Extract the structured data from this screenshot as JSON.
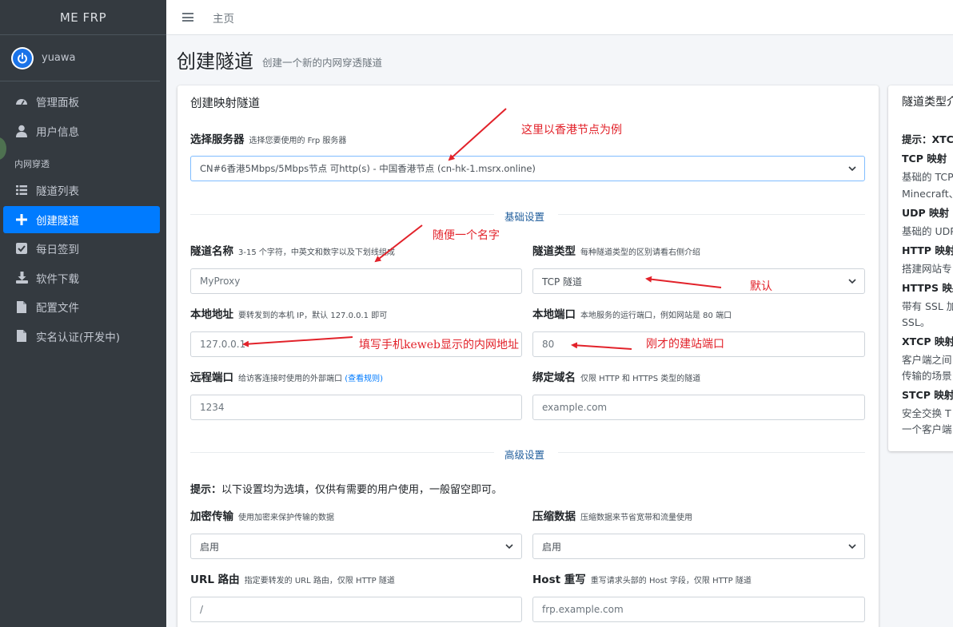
{
  "app": {
    "brand": "ME FRP",
    "username": "yuawa"
  },
  "sidebar": {
    "items": [
      {
        "label": "管理面板",
        "icon": "dashboard-icon"
      },
      {
        "label": "用户信息",
        "icon": "user-icon"
      }
    ],
    "section_header": "内网穿透",
    "section_items": [
      {
        "label": "隧道列表",
        "icon": "list-icon"
      },
      {
        "label": "创建隧道",
        "icon": "plus-icon",
        "active": true
      },
      {
        "label": "每日签到",
        "icon": "checkbox-icon"
      },
      {
        "label": "软件下载",
        "icon": "download-icon"
      },
      {
        "label": "配置文件",
        "icon": "file-icon"
      },
      {
        "label": "实名认证(开发中)",
        "icon": "file-icon"
      }
    ]
  },
  "topbar": {
    "home": "主页"
  },
  "page": {
    "title": "创建隧道",
    "subtitle": "创建一个新的内网穿透隧道"
  },
  "form": {
    "card_title": "创建映射隧道",
    "server": {
      "label": "选择服务器",
      "hint": "选择您要使用的 Frp 服务器",
      "value": "CN#6香港5Mbps/5Mbps节点 可http(s) - 中国香港节点 (cn-hk-1.msrx.online)"
    },
    "basic_section": "基础设置",
    "tunnel_name": {
      "label": "隧道名称",
      "hint": "3-15 个字符，中英文和数字以及下划线组成",
      "placeholder": "MyProxy"
    },
    "tunnel_type": {
      "label": "隧道类型",
      "hint": "每种隧道类型的区别请看右侧介绍",
      "value": "TCP 隧道"
    },
    "local_addr": {
      "label": "本地地址",
      "hint": "要转发到的本机 IP，默认 127.0.0.1 即可",
      "placeholder": "127.0.0.1"
    },
    "local_port": {
      "label": "本地端口",
      "hint": "本地服务的运行端口，例如网站是 80 端口",
      "placeholder": "80"
    },
    "remote_port": {
      "label": "远程端口",
      "hint": "给访客连接时使用的外部端口",
      "hint_link": "(查看规则)",
      "placeholder": "1234"
    },
    "domain": {
      "label": "绑定域名",
      "hint": "仅限 HTTP 和 HTTPS 类型的隧道",
      "placeholder": "example.com"
    },
    "advanced_section": "高级设置",
    "tip_bold": "提示：",
    "tip_text": "以下设置均为选填，仅供有需要的用户使用，一般留空即可。",
    "encrypt": {
      "label": "加密传输",
      "hint": "使用加密来保护传输的数据",
      "value": "启用"
    },
    "compress": {
      "label": "压缩数据",
      "hint": "压缩数据来节省宽带和流量使用",
      "value": "启用"
    },
    "url_route": {
      "label": "URL 路由",
      "hint": "指定要转发的 URL 路由，仅限 HTTP 隧道",
      "placeholder": "/"
    },
    "host_rewrite": {
      "label": "Host 重写",
      "hint": "重写请求头部的 Host 字段，仅限 HTTP 隧道",
      "placeholder": "frp.example.com"
    }
  },
  "side_panel": {
    "title": "隧道类型介绍",
    "tip": "提示：XTCP",
    "tcp_title": "TCP 映射",
    "tcp_desc1": "基础的 TCP",
    "tcp_desc2": "Minecraft、",
    "udp_title": "UDP 映射",
    "udp_desc": "基础的 UDP",
    "http_title": "HTTP 映射",
    "http_desc": "搭建网站专",
    "https_title": "HTTPS 映射",
    "https_desc1": "带有 SSL 加",
    "https_desc2": "SSL。",
    "xtcp_title": "XTCP 映射",
    "xtcp_desc1": "客户端之间",
    "xtcp_desc2": "传输的场景",
    "stcp_title": "STCP 映射",
    "stcp_desc1": "安全交换 T",
    "stcp_desc2": "一个客户端"
  },
  "annotations": {
    "server": "这里以香港节点为例",
    "name": "随便一个名字",
    "type": "默认",
    "local_addr": "填写手机keweb显示的内网地址",
    "local_port": "刚才的建站端口"
  },
  "colors": {
    "accent": "#007bff",
    "annotation": "#e2222a",
    "sidebar": "#343a40"
  }
}
